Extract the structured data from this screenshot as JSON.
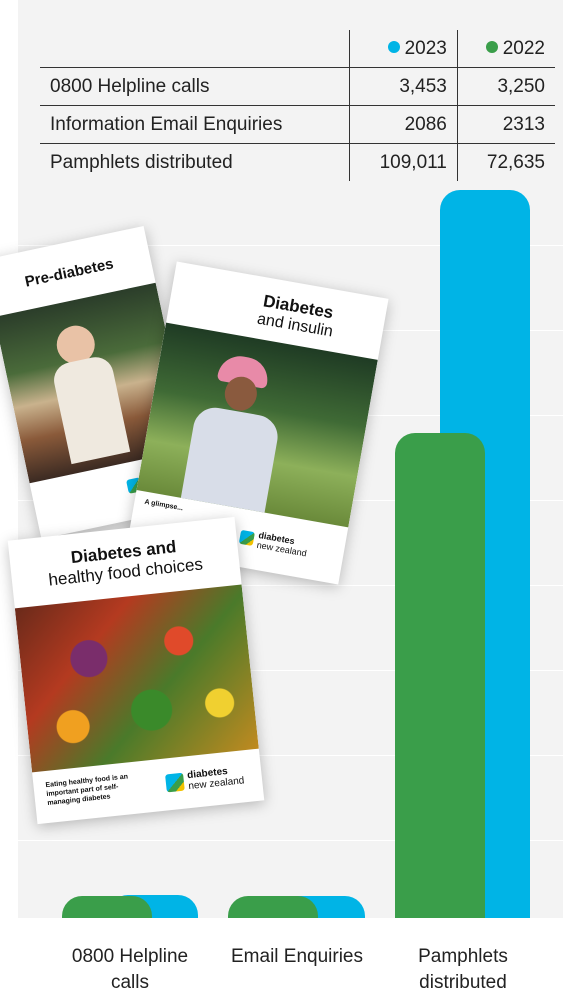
{
  "chart_data": {
    "type": "bar",
    "categories": [
      "0800 Helpline calls",
      "Email Enquiries",
      "Pamphlets distributed"
    ],
    "series": [
      {
        "name": "2022",
        "color": "#3a9e4a",
        "values": [
          3250,
          2313,
          72635
        ]
      },
      {
        "name": "2023",
        "color": "#00b4e6",
        "values": [
          3453,
          2086,
          109011
        ]
      }
    ],
    "ylim": [
      0,
      115000
    ],
    "grid": true,
    "legend": "in table header"
  },
  "table": {
    "headers": [
      "2023",
      "2022"
    ],
    "rows": [
      {
        "label": "0800 Helpline calls",
        "v2023": "3,453",
        "v2022": "3,250"
      },
      {
        "label": "Information Email Enquiries",
        "v2023": "2086",
        "v2022": "2313"
      },
      {
        "label": "Pamphlets distributed",
        "v2023": "109,011",
        "v2022": "72,635"
      }
    ]
  },
  "xlabels": [
    {
      "line1": "0800 Helpline",
      "line2": "calls"
    },
    {
      "line1": "Email Enquiries",
      "line2": ""
    },
    {
      "line1": "Pamphlets",
      "line2": "distributed"
    }
  ],
  "brochures": {
    "prediabetes": {
      "title": "Pre-diabetes"
    },
    "insulin": {
      "title1": "Diabetes",
      "title2": "and insulin",
      "tagline": "A glimpse...",
      "brand1": "diabetes",
      "brand2": "new zealand"
    },
    "food": {
      "title1": "Diabetes and",
      "title2": "healthy food choices",
      "tagline": "Eating healthy food is an important part of self-managing diabetes",
      "brand1": "diabetes",
      "brand2": "new zealand"
    }
  }
}
